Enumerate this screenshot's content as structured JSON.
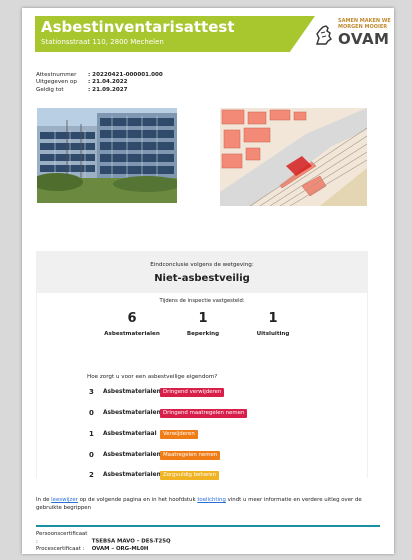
{
  "header": {
    "title": "Asbestinventarisattest",
    "address": "Stationsstraat 110, 2800 Mechelen",
    "tagline": "SAMEN MAKEN WE MORGEN MOOIER",
    "brand": "OVAM",
    "accent_color": "#a8c62e"
  },
  "meta": [
    {
      "label": "Attestnummer",
      "value": ": 20220421-000001.000"
    },
    {
      "label": "Uitgegeven op",
      "value": ": 21.04.2022"
    },
    {
      "label": "Geldig tot",
      "value": ": 21.09.2027"
    }
  ],
  "conclusion": {
    "heading": "Eindconclusie volgens de wetgeving:",
    "verdict": "Niet-asbestveilig",
    "findings_heading": "Tijdens de inspectie vastgesteld:",
    "stats": [
      {
        "count": "6",
        "label": "Asbestmaterialen"
      },
      {
        "count": "1",
        "label": "Beperking"
      },
      {
        "count": "1",
        "label": "Uitsluiting"
      }
    ],
    "question": "Hoe zorgt u voor een asbestveilige eigendom?",
    "actions": [
      {
        "count": "3",
        "noun": "Asbestmaterialen",
        "action": "Dringend verwijderen",
        "color": "#d81f4a"
      },
      {
        "count": "0",
        "noun": "Asbestmaterialen",
        "action": "Dringend maatregelen nemen",
        "color": "#d81f4a"
      },
      {
        "count": "1",
        "noun": "Asbestmateriaal",
        "action": "Verwijderen",
        "color": "#f07c16"
      },
      {
        "count": "0",
        "noun": "Asbestmaterialen",
        "action": "Maatregelen nemen",
        "color": "#f07c16"
      },
      {
        "count": "2",
        "noun": "Asbestmaterialen",
        "action": "Zorgvuldig beheren",
        "color": "#f0b323"
      }
    ]
  },
  "note": {
    "part1": "In de ",
    "link1": "leeswijzer",
    "part2": " op de volgende pagina en in het hoofdstuk ",
    "link2": "toelichting",
    "part3": " vindt u meer informatie en verdere uitleg over de gebruikte begrippen"
  },
  "certificates": [
    {
      "label": "Persoonscertificaat :",
      "value": "TSEBSA MAVO – DES-T25Q"
    },
    {
      "label": "Procescertificaat :",
      "value": "OVAM – ORG-ML0H"
    }
  ]
}
